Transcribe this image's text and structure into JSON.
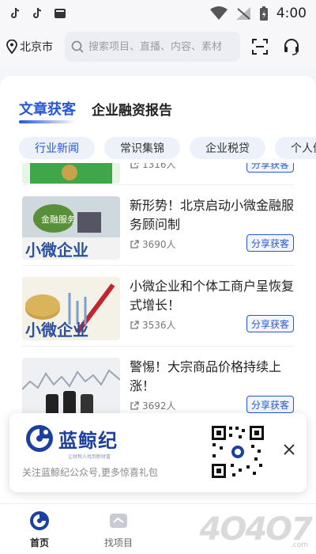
{
  "status_bar": {
    "time": "4:00",
    "left_icons": [
      "tiktok-icon",
      "tiktok-icon",
      "news-icon"
    ]
  },
  "header": {
    "location": "北京市",
    "search_placeholder": "搜索项目、直播、内容、素材"
  },
  "tabs": [
    {
      "label": "文章获客",
      "active": true
    },
    {
      "label": "企业融资报告",
      "active": false
    }
  ],
  "chips": [
    {
      "label": "行业新闻",
      "active": true
    },
    {
      "label": "常识集锦",
      "active": false
    },
    {
      "label": "企业税贷",
      "active": false
    },
    {
      "label": "个人信",
      "active": false
    }
  ],
  "articles": [
    {
      "title": "",
      "views": "1316人",
      "share_label": "分享获客"
    },
    {
      "title": "新形势！北京启动小微金融服务顾问制",
      "views": "3690人",
      "share_label": "分享获客"
    },
    {
      "title": "小微企业和个体工商户呈恢复式增长！",
      "views": "3536人",
      "share_label": "分享获客"
    },
    {
      "title": "警惕！大宗商品价格持续上涨！",
      "views": "3692人",
      "share_label": "分享获客"
    }
  ],
  "banner": {
    "brand_name": "蓝鲸纪",
    "brand_sub": "让财税人找到新财富",
    "text": "关注蓝鲸纪公众号,更多惊喜礼包"
  },
  "bottom_nav": [
    {
      "label": "首页",
      "icon": "home-icon",
      "active": true
    },
    {
      "label": "找项目",
      "icon": "project-icon",
      "active": false
    }
  ],
  "watermark": {
    "text": "4O4O7",
    "sub": ".com"
  },
  "colors": {
    "accent": "#2557d6",
    "brand": "#1c3fa0",
    "chip_bg": "#edf1fa"
  }
}
